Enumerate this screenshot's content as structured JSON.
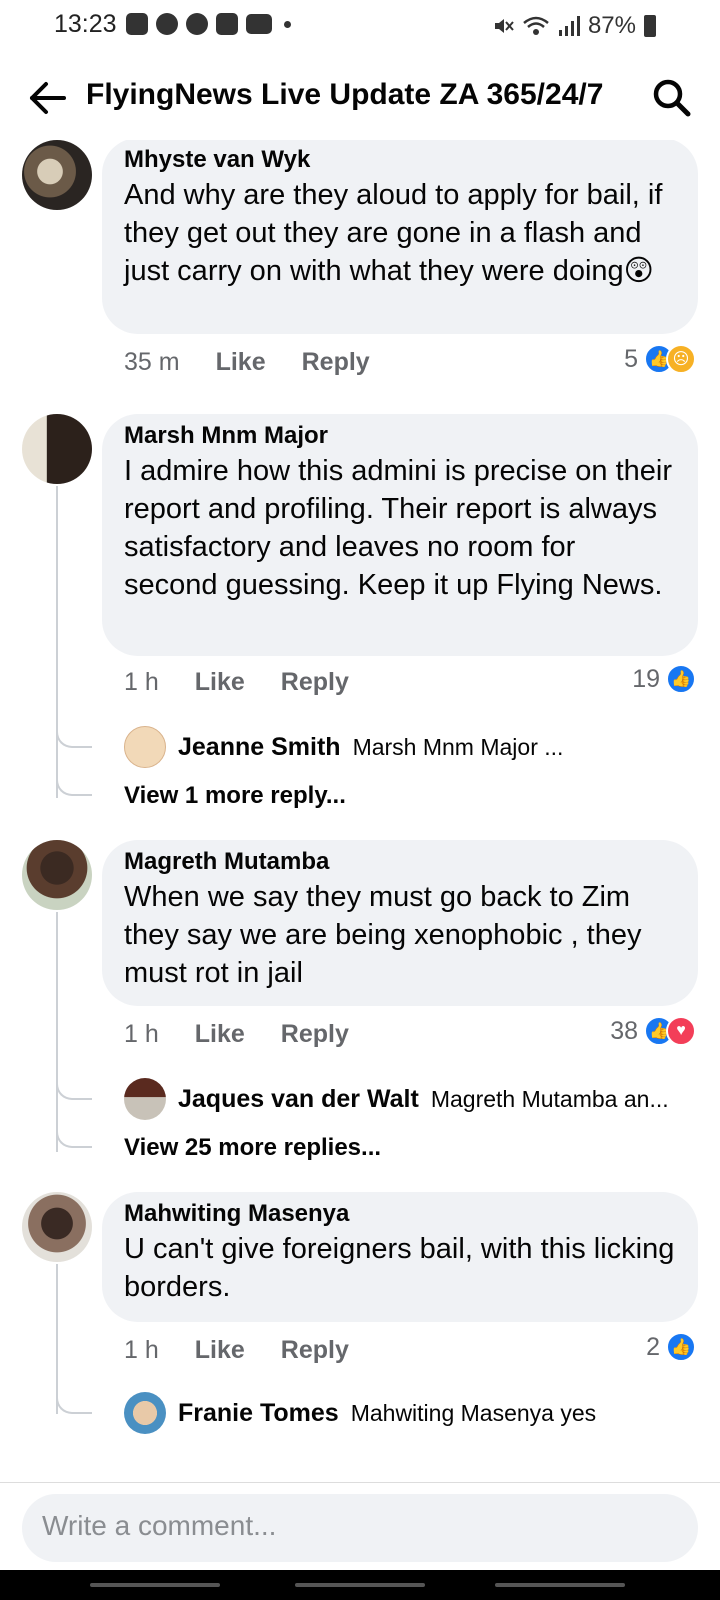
{
  "status_bar": {
    "time": "13:23",
    "battery": "87%"
  },
  "header": {
    "title": "FlyingNews Live Update ZA 365/24/7"
  },
  "comments": [
    {
      "author": "Mhyste van Wyk",
      "text": "And why are they aloud to apply for bail, if they get out they are gone in a flash and just carry on with what they were doing😲",
      "time": "35 m",
      "like": "Like",
      "reply": "Reply",
      "reaction_count": "5"
    },
    {
      "author": "Marsh Mnm Major",
      "text": "I admire how this admini is precise  on their report and profiling. Their report is always satisfactory and leaves no room for second guessing. Keep it up Flying News.",
      "time": "1 h",
      "like": "Like",
      "reply": "Reply",
      "reaction_count": "19",
      "reply_preview": {
        "name": "Jeanne Smith",
        "snippet": "Marsh Mnm Major ..."
      },
      "more_replies": "View 1 more reply..."
    },
    {
      "author": "Magreth Mutamba",
      "text": "When we say they must go back to Zim they say we are being xenophobic , they must rot in jail",
      "time": "1 h",
      "like": "Like",
      "reply": "Reply",
      "reaction_count": "38",
      "reply_preview": {
        "name": "Jaques van der Walt",
        "snippet": "Magreth Mutamba an..."
      },
      "more_replies": "View 25 more replies..."
    },
    {
      "author": "Mahwiting Masenya",
      "text": "U can't give foreigners bail, with this licking borders.",
      "time": "1 h",
      "like": "Like",
      "reply": "Reply",
      "reaction_count": "2",
      "reply_preview": {
        "name": "Franie Tomes",
        "snippet": "Mahwiting Masenya yes"
      }
    }
  ],
  "composer": {
    "placeholder": "Write a comment..."
  },
  "colors": {
    "like_blue": "#1877f2",
    "bubble_bg": "#f0f2f5",
    "meta_gray": "#65676b"
  }
}
